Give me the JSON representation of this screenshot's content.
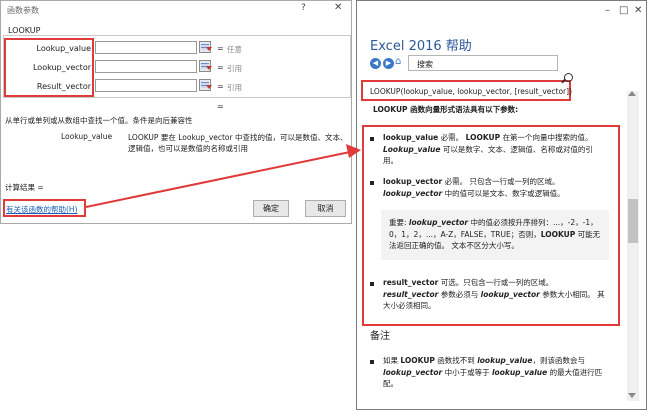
{
  "dialog": {
    "title": "函数参数",
    "help_icon": "?",
    "close_icon": "✕",
    "function_name": "LOOKUP",
    "args": [
      {
        "label": "Lookup_value",
        "value": "",
        "hint": "任意"
      },
      {
        "label": "Lookup_vector",
        "value": "",
        "hint": "引用"
      },
      {
        "label": "Result_vector",
        "value": "",
        "hint": "引用"
      }
    ],
    "equals": "=",
    "description": "从单行或单列或从数组中查找一个值。条件是向后兼容性",
    "arg_desc_name": "Lookup_value",
    "arg_desc_text": "LOOKUP 要在 Lookup_vector 中查找的值，可以是数值、文本、逻辑值，也可以是数值的名称或引用",
    "calc_result": "计算结果 =",
    "help_link": "有关该函数的帮助(H)",
    "ok_label": "确定",
    "cancel_label": "取消"
  },
  "help_window": {
    "title": "Excel 2016 帮助",
    "search_placeholder": "搜索",
    "syntax": "LOOKUP(lookup_value, lookup_vector, [result_vector])",
    "intro": "LOOKUP 函数向量形式语法具有以下参数:",
    "p1_name": "lookup_value",
    "p1_a": "   必需。 ",
    "p1_b": "LOOKUP",
    "p1_c": " 在第一个向量中搜索的值。",
    "p1_d": "Lookup_value",
    "p1_e": " 可以是数字、文本、逻辑值、名称或对值的引用。",
    "p2_name": "lookup_vector",
    "p2_a": "    必需。 只包含一行或一列的区域。",
    "p2_b": "lookup_vector",
    "p2_c": " 中的值可以是文本、数字或逻辑值。",
    "note_a": "重要: ",
    "note_b": "lookup_vector",
    "note_c": " 中的值必须按升序排列：...，-2，-1，0，1，2，...，A-Z，FALSE，TRUE；否则，",
    "note_d": "LOOKUP",
    "note_e": " 可能无法返回正确的值。 文本不区分大小写。",
    "p3_name": "result_vector",
    "p3_a": "    可选。只包含一行或一列的区域。",
    "p3_b": "result_vector",
    "p3_c": " 参数必须与 ",
    "p3_d": "lookup_vector",
    "p3_e": " 参数大小相同。 其大小必须相同。",
    "remarks_heading": "备注",
    "r1_a": "如果 ",
    "r1_b": "LOOKUP",
    "r1_c": " 函数找不到 ",
    "r1_d": "lookup_value",
    "r1_e": "，则该函数会与 ",
    "r1_f": "lookup_vector",
    "r1_g": " 中小于或等于 ",
    "r1_h": "lookup_value",
    "r1_i": " 的最大值进行匹配。"
  },
  "colors": {
    "annotation_red": "#e03a3a",
    "link_blue": "#1a5fb4",
    "help_title_blue": "#2b579a"
  }
}
